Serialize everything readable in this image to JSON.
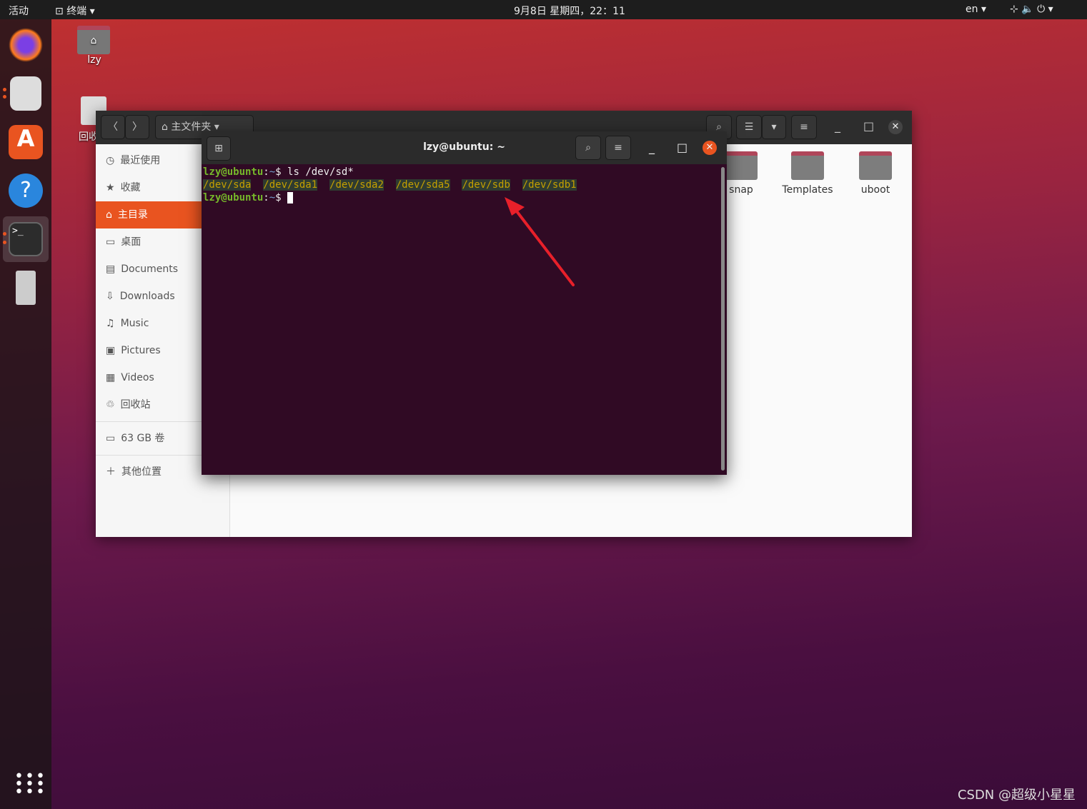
{
  "topbar": {
    "activities": "活动",
    "app": "终端",
    "clock": "9月8日 星期四，22：11",
    "lang": "en"
  },
  "desktop": {
    "home_label": "lzy",
    "trash_label": "回收站"
  },
  "files": {
    "location": "主文件夹",
    "sidebar": [
      "最近使用",
      "收藏",
      "主目录",
      "桌面",
      "Documents",
      "Downloads",
      "Music",
      "Pictures",
      "Videos",
      "回收站"
    ],
    "volume": "63 GB 卷",
    "other": "其他位置",
    "folders": [
      "snap",
      "Templates",
      "uboot"
    ]
  },
  "terminal": {
    "title": "lzy@ubuntu: ~",
    "prompt_user": "lzy@ubuntu",
    "prompt_path": "~",
    "command": "ls /dev/sd*",
    "output": [
      "/dev/sda",
      "/dev/sda1",
      "/dev/sda2",
      "/dev/sda5",
      "/dev/sdb",
      "/dev/sdb1"
    ]
  },
  "watermark": "CSDN @超级小星星",
  "colors": {
    "accent": "#e95420",
    "terminal_bg": "#300a24",
    "arrow": "#e8202a"
  }
}
